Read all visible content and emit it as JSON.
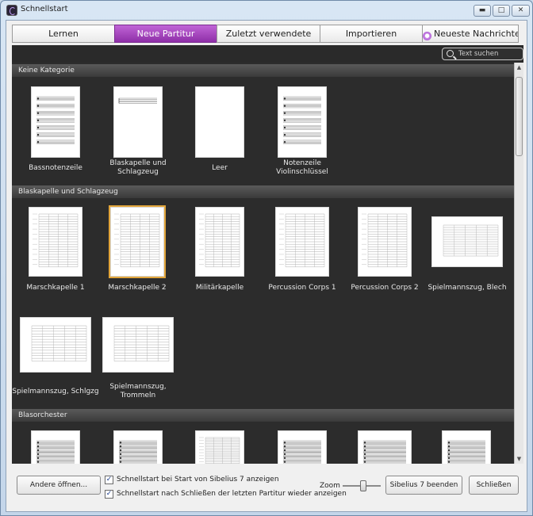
{
  "window": {
    "title": "Schnellstart"
  },
  "tabs": [
    {
      "label": "Lernen",
      "active": false,
      "bullet": false
    },
    {
      "label": "Neue Partitur",
      "active": true,
      "bullet": false
    },
    {
      "label": "Zuletzt verwendete",
      "active": false,
      "bullet": false
    },
    {
      "label": "Importieren",
      "active": false,
      "bullet": false
    },
    {
      "label": "Neueste Nachrichten",
      "active": false,
      "bullet": true
    }
  ],
  "search": {
    "placeholder": "Text suchen"
  },
  "categories": [
    {
      "name": "Keine Kategorie",
      "items": [
        {
          "label": "Bassnotenzeile",
          "thumb": "portrait-staves"
        },
        {
          "label": "Blaskapelle und Schlagzeug",
          "thumb": "portrait-single"
        },
        {
          "label": "Leer",
          "thumb": "portrait-blank"
        },
        {
          "label": "Notenzeile Violinschlüssel",
          "thumb": "portrait-staves"
        }
      ]
    },
    {
      "name": "Blaskapelle und Schlagzeug",
      "items": [
        {
          "label": "Marschkapelle 1",
          "thumb": "score-dense"
        },
        {
          "label": "Marschkapelle 2",
          "thumb": "score-dense",
          "selected": true
        },
        {
          "label": "Militärkapelle",
          "thumb": "score-dense"
        },
        {
          "label": "Percussion Corps 1",
          "thumb": "score-dense"
        },
        {
          "label": "Percussion Corps 2",
          "thumb": "score-dense"
        },
        {
          "label": "Spielmannszug, Blech",
          "thumb": "landscape"
        },
        {
          "label": "Spielmannszug, Schlgzg",
          "thumb": "landscape"
        },
        {
          "label": "Spielmannszug, Trommeln",
          "thumb": "landscape"
        }
      ]
    },
    {
      "name": "Blasorchester",
      "items": [
        {
          "label": "",
          "thumb": "portrait-staves"
        },
        {
          "label": "",
          "thumb": "portrait-staves"
        },
        {
          "label": "",
          "thumb": "score-dense"
        },
        {
          "label": "",
          "thumb": "portrait-staves"
        },
        {
          "label": "",
          "thumb": "portrait-staves"
        },
        {
          "label": "",
          "thumb": "portrait-staves"
        }
      ]
    }
  ],
  "footer": {
    "open_other_label": "Andere öffnen...",
    "checkbox1": {
      "label": "Schnellstart bei Start von Sibelius 7 anzeigen",
      "checked": true
    },
    "checkbox2": {
      "label": "Schnellstart nach Schließen der letzten Partitur wieder anzeigen",
      "checked": true
    },
    "zoom_label": "Zoom",
    "quit_label": "Sibelius 7 beenden",
    "close_label": "Schließen"
  },
  "colors": {
    "accent": "#a543c4",
    "selection": "#e2a53a",
    "panel": "#2c2c2c"
  },
  "icons": {
    "search": "search-icon",
    "check": "checkmark-icon",
    "app": "sibelius-app-icon"
  }
}
